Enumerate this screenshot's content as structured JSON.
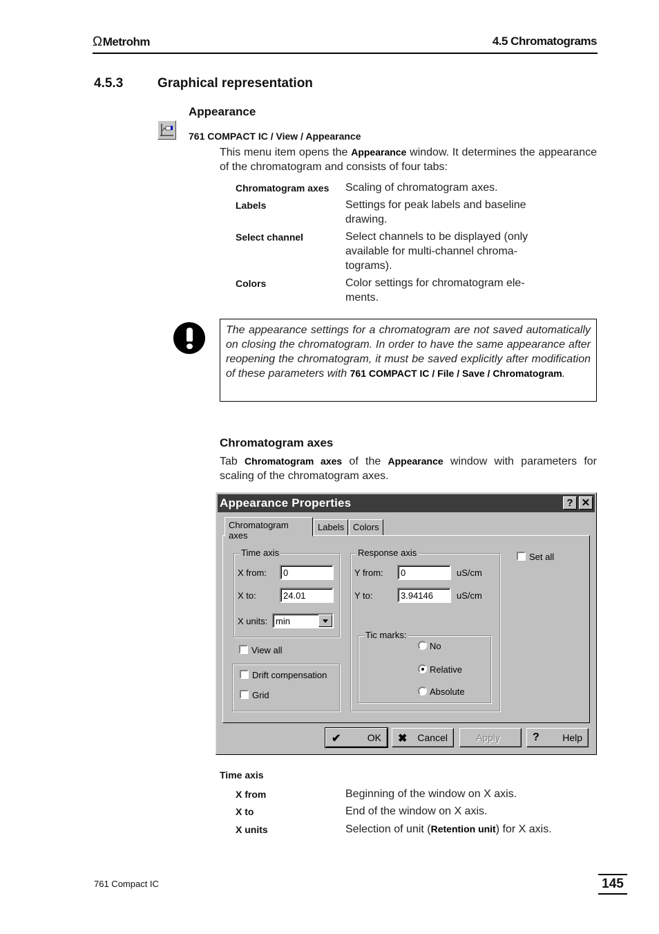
{
  "header": {
    "logo_text": "Metrohm",
    "logo_icon": "omega-icon",
    "chapter": "4.5 Chromatograms"
  },
  "section": {
    "number": "4.5.3",
    "title": "Graphical representation"
  },
  "appearance": {
    "title": "Appearance",
    "toolbar_icon": "chromatogram-appearance-icon",
    "menu_path": "761 COMPACT IC / View / Appearance",
    "intro_before": "This menu item opens the ",
    "intro_bold": "Appearance",
    "intro_after": " window. It determines the ap­pearance of the chromatogram and consists of four tabs:",
    "tabs_list": [
      {
        "term": "Chromatogram axes",
        "desc": "Scaling of chromatogram axes."
      },
      {
        "term": "Labels",
        "desc": "Settings for peak labels and baseline drawing."
      },
      {
        "term": "Select channel",
        "desc": "Select channels to be displayed (only available for multi-channel chroma­tograms)."
      },
      {
        "term": "Colors",
        "desc": "Color settings for chromatogram ele­ments."
      }
    ]
  },
  "note": {
    "icon": "exclamation-icon",
    "text": "The appearance settings for a chromatogram are not saved automati­cally on closing the chromatogram. In order to have the same appear­ance after reopening the chromatogram, it must be saved explicitly after modification of these parameters with ",
    "path_bold": "761 COMPACT IC / File / Save / Chromatogram",
    "end": "."
  },
  "chrom_axes": {
    "title": "Chromatogram axes",
    "p_tab": "Tab ",
    "p_bold1": "Chromatogram axes",
    "p_mid": " of the ",
    "p_bold2": "Appearance",
    "p_end": " window with parameters for scaling of the chromatogram axes."
  },
  "dialog": {
    "title": "Appearance Properties",
    "help_btn": "?",
    "close_btn": "✕",
    "tabs": [
      "Chromatogram axes",
      "Labels",
      "Colors"
    ],
    "active_tab": "Chromatogram axes",
    "time_axis": {
      "label": "Time axis",
      "x_from_label": "X from:",
      "x_from_value": "0",
      "x_to_label": "X to:",
      "x_to_value": "24.01",
      "x_units_label": "X units:",
      "x_units_value": "min"
    },
    "view_all": {
      "label": "View all",
      "checked": false
    },
    "drift_compensation": {
      "label": "Drift compensation",
      "checked": false
    },
    "grid": {
      "label": "Grid",
      "checked": false
    },
    "response_axis": {
      "label": "Response axis",
      "y_from_label": "Y from:",
      "y_from_value": "0",
      "y_from_unit": "uS/cm",
      "y_to_label": "Y to:",
      "y_to_value": "3.94146",
      "y_to_unit": "uS/cm"
    },
    "tic_marks": {
      "label": "Tic marks:",
      "options": [
        "No",
        "Relative",
        "Absolute"
      ],
      "selected": "Relative"
    },
    "set_all": {
      "label": "Set all",
      "checked": false
    },
    "buttons": {
      "ok": "OK",
      "cancel": "Cancel",
      "apply": "Apply",
      "help": "Help"
    }
  },
  "time_axis_section": {
    "title": "Time axis",
    "items": [
      {
        "term": "X from",
        "desc": "Beginning of the window on X axis."
      },
      {
        "term": "X to",
        "desc": "End of the window on X axis."
      },
      {
        "term": "X units",
        "desc_before": "Selection of unit (",
        "desc_bold": "Retention unit",
        "desc_after": ") for X axis."
      }
    ]
  },
  "footer": {
    "product": "761 Compact IC",
    "page_number": "145"
  }
}
